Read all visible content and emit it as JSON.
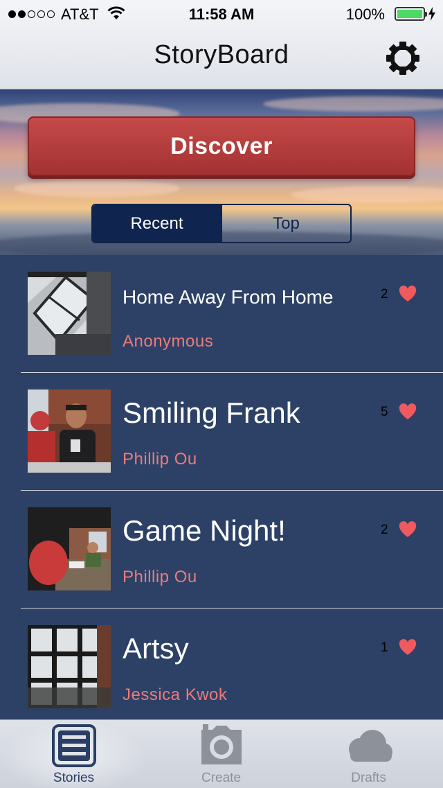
{
  "status_bar": {
    "carrier": "AT&T",
    "time": "11:58 AM",
    "battery": "100%"
  },
  "nav": {
    "title": "StoryBoard"
  },
  "hero": {
    "discover_label": "Discover",
    "segments": [
      {
        "label": "Recent",
        "selected": true
      },
      {
        "label": "Top",
        "selected": false
      }
    ]
  },
  "stories": [
    {
      "title": "Home Away From Home",
      "author": "Anonymous",
      "likes": "2"
    },
    {
      "title": "Smiling Frank",
      "author": "Phillip Ou",
      "likes": "5"
    },
    {
      "title": "Game Night!",
      "author": "Phillip Ou",
      "likes": "2"
    },
    {
      "title": "Artsy",
      "author": "Jessica Kwok",
      "likes": "1"
    }
  ],
  "tabbar": {
    "tabs": [
      {
        "label": "Stories",
        "icon": "list-icon",
        "active": true
      },
      {
        "label": "Create",
        "icon": "camera-icon",
        "active": false
      },
      {
        "label": "Drafts",
        "icon": "cloud-icon",
        "active": false
      }
    ]
  },
  "colors": {
    "list_background": "#2d4166",
    "author_text": "#ee7a7a",
    "heart": "#f05a5f",
    "discover_button": "#b53d3d",
    "segment_selected": "#0f2550"
  }
}
